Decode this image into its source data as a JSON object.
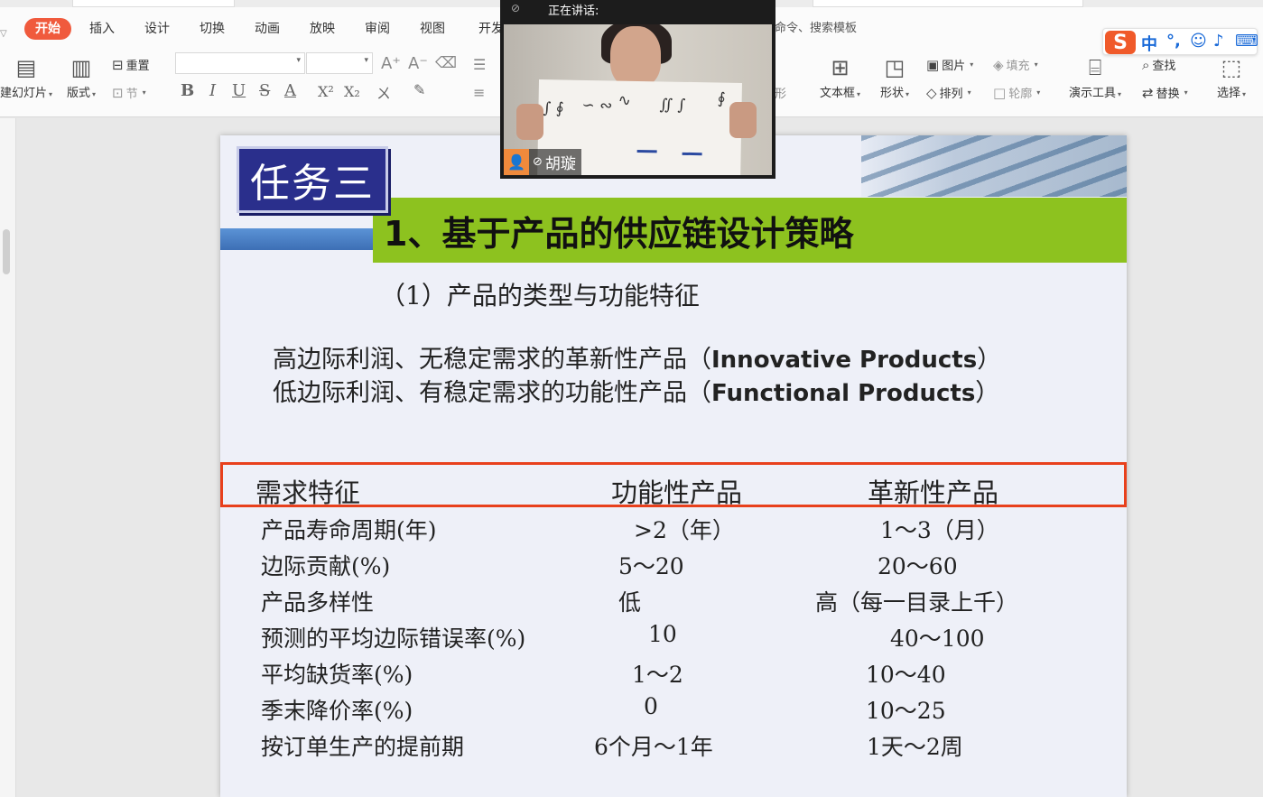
{
  "ribbon": {
    "tabs": [
      "开始",
      "插入",
      "设计",
      "切换",
      "动画",
      "放映",
      "审阅",
      "视图",
      "开发"
    ],
    "active_tab": "开始",
    "search_hint": "命令、搜索模板",
    "clipboard": {
      "new_slide": "建幻灯片",
      "layout": "版式",
      "reset": "重置",
      "section": "节"
    },
    "insert": {
      "textbox": "文本框",
      "shape": "形状",
      "picture": "图片",
      "fill": "填充",
      "arrange": "排列",
      "outline": "轮廓",
      "shape_fill_partial": "形",
      "presenter_tools": "演示工具",
      "find": "查找",
      "replace": "替换",
      "select": "选择"
    },
    "format_glyphs": [
      "B",
      "I",
      "U",
      "S",
      "A",
      "X²",
      "X₂"
    ]
  },
  "video": {
    "speaking_label": "正在讲话:",
    "participant_name": "胡璇"
  },
  "ime": {
    "mode": "中"
  },
  "slide": {
    "badge": "任务三",
    "title": "1、基于产品的供应链设计策略",
    "subtitle": "（1）产品的类型与功能特征",
    "desc_1_prefix": "高边际利润、无稳定需求的革新性产品（",
    "desc_1_en": "Innovative Products",
    "desc_1_suffix": "）",
    "desc_2_prefix": "低边际利润、有稳定需求的功能性产品（",
    "desc_2_en": "Functional Products",
    "desc_2_suffix": "）",
    "table": {
      "headers": [
        "需求特征",
        "功能性产品",
        "革新性产品"
      ],
      "rows": [
        [
          "产品寿命周期(年)",
          ">2（年）",
          "1～3（月）"
        ],
        [
          "边际贡献(%)",
          "5～20",
          "20～60"
        ],
        [
          "产品多样性",
          "低",
          "高（每一目录上千）"
        ],
        [
          "预测的平均边际错误率(%)",
          "10",
          "40～100"
        ],
        [
          "平均缺货率(%)",
          "1～2",
          "10～40"
        ],
        [
          "季末降价率(%)",
          "0",
          "10～25"
        ],
        [
          "按订单生产的提前期",
          "6个月～1年",
          "1天～2周"
        ]
      ]
    }
  }
}
